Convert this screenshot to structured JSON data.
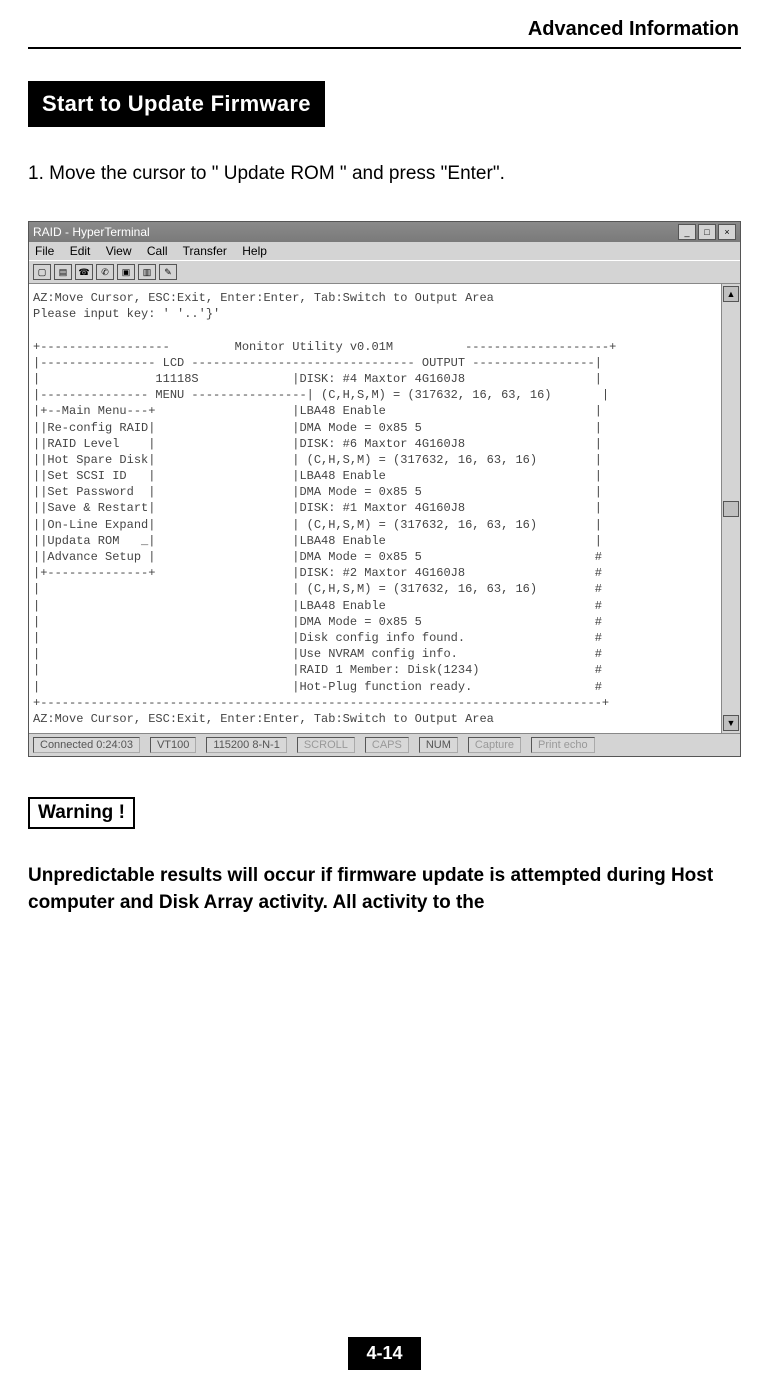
{
  "header": {
    "title": "Advanced Information"
  },
  "section_title": "Start to Update Firmware",
  "step1": "1. Move the cursor to \" Update ROM \" and press \"Enter\".",
  "ht": {
    "title": "RAID - HyperTerminal",
    "menu": {
      "file": "File",
      "edit": "Edit",
      "view": "View",
      "call": "Call",
      "transfer": "Transfer",
      "help": "Help"
    },
    "terminal_text": "AZ:Move Cursor, ESC:Exit, Enter:Enter, Tab:Switch to Output Area\nPlease input key: ' '..'}'\n\n+------------------         Monitor Utility v0.01M          --------------------+\n|---------------- LCD ------------------------------- OUTPUT -----------------|\n|                11118S             |DISK: #4 Maxtor 4G160J8                  |\n|--------------- MENU ----------------| (C,H,S,M) = (317632, 16, 63, 16)       |\n|+--Main Menu---+                   |LBA48 Enable                             |\n||Re-config RAID|                   |DMA Mode = 0x85 5                        |\n||RAID Level    |                   |DISK: #6 Maxtor 4G160J8                  |\n||Hot Spare Disk|                   | (C,H,S,M) = (317632, 16, 63, 16)        |\n||Set SCSI ID   |                   |LBA48 Enable                             |\n||Set Password  |                   |DMA Mode = 0x85 5                        |\n||Save & Restart|                   |DISK: #1 Maxtor 4G160J8                  |\n||On-Line Expand|                   | (C,H,S,M) = (317632, 16, 63, 16)        |\n||Updata ROM   _|                   |LBA48 Enable                             |\n||Advance Setup |                   |DMA Mode = 0x85 5                        #\n|+--------------+                   |DISK: #2 Maxtor 4G160J8                  #\n|                                   | (C,H,S,M) = (317632, 16, 63, 16)        #\n|                                   |LBA48 Enable                             #\n|                                   |DMA Mode = 0x85 5                        #\n|                                   |Disk config info found.                  #\n|                                   |Use NVRAM config info.                   #\n|                                   |RAID 1 Member: Disk(1234)                #\n|                                   |Hot-Plug function ready.                 #\n+------------------------------------------------------------------------------+\nAZ:Move Cursor, ESC:Exit, Enter:Enter, Tab:Switch to Output Area",
    "status": {
      "connected": "Connected 0:24:03",
      "term": "VT100",
      "baud": "115200 8-N-1",
      "scroll": "SCROLL",
      "caps": "CAPS",
      "num": "NUM",
      "capture": "Capture",
      "print": "Print echo"
    }
  },
  "warning_label": "Warning !",
  "warning_text": "Unpredictable results will occur if firmware update is attempted during Host computer and Disk Array activity. All activity to the",
  "page_number": "4-14"
}
